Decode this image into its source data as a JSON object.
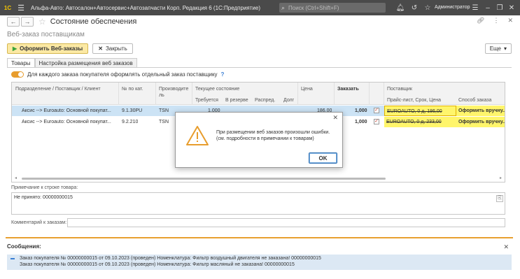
{
  "app": {
    "logo": "1С",
    "title": "Альфа-Авто: Автосалон+Автосервис+Автозапчасти Корп. Редакция 6 (1С:Предприятие)",
    "search_placeholder": "Поиск (Ctrl+Shift+F)",
    "user": "Администратор"
  },
  "window": {
    "title": "Состояние обеспечения",
    "subtitle": "Веб-заказ поставщикам"
  },
  "commands": {
    "place_orders": "Оформить Веб-заказы",
    "close": "Закрыть",
    "more": "Еще"
  },
  "tabs": [
    {
      "label": "Товары"
    },
    {
      "label": "Настройка размещения веб заказов"
    }
  ],
  "option": {
    "label": "Для каждого заказа покупателя оформлять отдельный заказ поставщику",
    "help": "?",
    "enabled": true
  },
  "grid": {
    "headers": {
      "division": "Подразделение / Поставщик / Клиент",
      "cat_no": "№ по кат.",
      "manufacturer": "Производите ль",
      "state": "Текущее состояние",
      "required": "Требуется",
      "reserved": "В резерве",
      "distributed": "Распред.",
      "debt": "Долг",
      "price": "Цена",
      "order": "Заказать",
      "supplier": "Поставщик",
      "price_list": "Прайс-лист, Срок, Цена",
      "order_method": "Способ заказа"
    },
    "rows": [
      {
        "division": "Аксис  --> Euroauto: Основной покупат...",
        "cat_no": "9.1.30PU",
        "manufacturer": "TSN",
        "required": "1,000",
        "price": "186,00",
        "order": "1,000",
        "checked": true,
        "price_list": "EUROAUTO, 0 д, 186,00",
        "order_method": "Оформить вручну..."
      },
      {
        "division": "Аксис  --> Euroauto: Основной покупат...",
        "cat_no": "9.2.210",
        "manufacturer": "TSN",
        "required": "",
        "price": "",
        "order": "1,000",
        "checked": true,
        "price_list": "EUROAUTO, 0 д, 233,00",
        "order_method": "Оформить вручну..."
      }
    ]
  },
  "note": {
    "label": "Примечание к строке товара:",
    "value": "Не принято: 00000000015"
  },
  "comment": {
    "label": "Комментарий к заказам:",
    "value": ""
  },
  "messages": {
    "title": "Сообщения:",
    "items": [
      "Заказ покупателя № 00000000015 от 09.10.2023 (проведен) Номенклатура: Фильтр воздушный двигателя не заказана! 00000000015",
      "Заказ покупателя № 00000000015 от 09.10.2023 (проведен) Номенклатура: Фильтр масляный не заказана! 00000000015"
    ]
  },
  "dialog": {
    "line1": "При размещении веб заказов произошли ошибки.",
    "line2": "(см. подробности в примечании к товарам)",
    "ok": "OK"
  },
  "colors": {
    "accent": "#e8a030",
    "selection": "#cce3f5",
    "highlight": "#fff56b"
  }
}
